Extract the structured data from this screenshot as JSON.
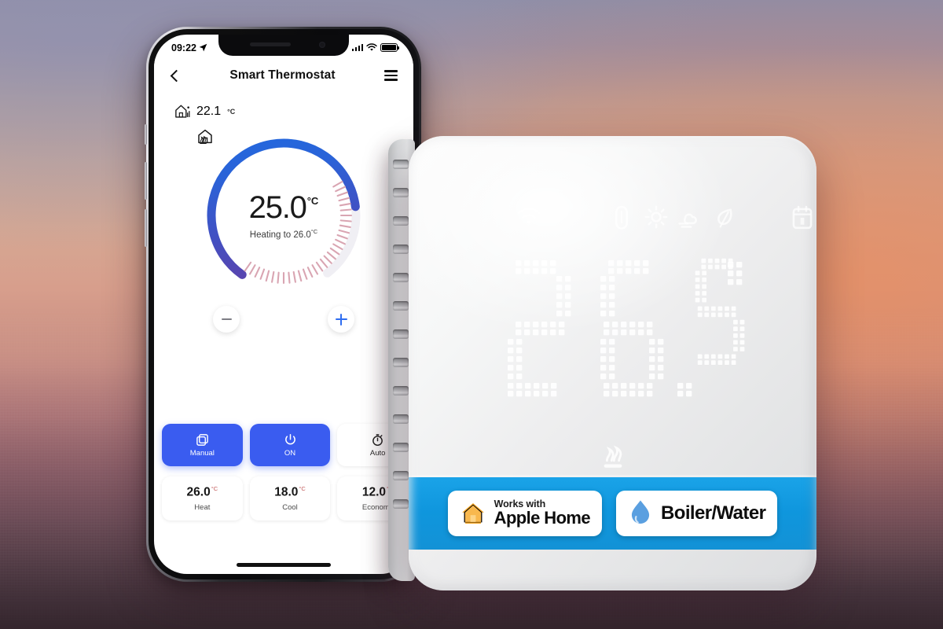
{
  "background": {
    "description": "sunset gradient backdrop",
    "colors": {
      "top": "#8f8fa8",
      "upper_mid": "#cdab9a",
      "warm_accent": "#e78d60",
      "lower_mid": "#96626d",
      "bottom": "#403039"
    }
  },
  "phone": {
    "status_bar": {
      "time": "09:22",
      "location_icon": "location-arrow-icon",
      "signal_icon": "cellular-signal-icon",
      "wifi_icon": "wifi-icon",
      "battery_icon": "battery-icon"
    },
    "nav": {
      "back_icon": "chevron-left-icon",
      "title": "Smart Thermostat",
      "menu_icon": "hamburger-menu-icon"
    },
    "ambient": {
      "icon": "home-sensor-icon",
      "value": "22.1",
      "unit": "°C"
    },
    "dial": {
      "home_icon": "home-icon",
      "temperature": "25.0",
      "unit": "°C",
      "status_text": "Heating to 26.0",
      "status_unit": "°C",
      "mode_icon": "heating-flame-icon",
      "gauge": {
        "min": 5,
        "max": 35,
        "current": 25.0,
        "target": 26.0,
        "arc_start_color": "#1f5fd8",
        "arc_end_color": "#6b3fa8",
        "tick_color": "#d8a8b4"
      },
      "decrease_button": "−",
      "increase_button": "+"
    },
    "modes": [
      {
        "icon": "manual-copy-icon",
        "label": "Manual",
        "active": true
      },
      {
        "icon": "power-icon",
        "label": "ON",
        "active": true
      },
      {
        "icon": "stopwatch-icon",
        "label": "Auto",
        "active": false
      }
    ],
    "presets": [
      {
        "temp": "26.0",
        "unit": "°C",
        "label": "Heat"
      },
      {
        "temp": "18.0",
        "unit": "°C",
        "label": "Cool"
      },
      {
        "temp": "12.0",
        "unit": "°C",
        "label": "Economy"
      }
    ],
    "accent_color": "#3a5cf0",
    "home_indicator": "home-indicator-bar"
  },
  "device": {
    "status_icons": [
      "wifi-icon",
      "thermometer-icon",
      "sun-icon",
      "cloud-wind-icon",
      "leaf-eco-icon",
      "calendar-schedule-icon"
    ],
    "display": {
      "value": "26.5",
      "unit": "°",
      "style": "dot-matrix-led"
    },
    "heat_indicator_icon": "heating-waves-icon",
    "band_color": "#0f96dd",
    "badges": [
      {
        "icon": "apple-home-house-icon",
        "icon_color": "#f5a623",
        "line1": "Works with",
        "line2": "Apple Home"
      },
      {
        "icon": "water-droplet-icon",
        "icon_color": "#5a9fe0",
        "text": "Boiler/Water"
      }
    ]
  }
}
